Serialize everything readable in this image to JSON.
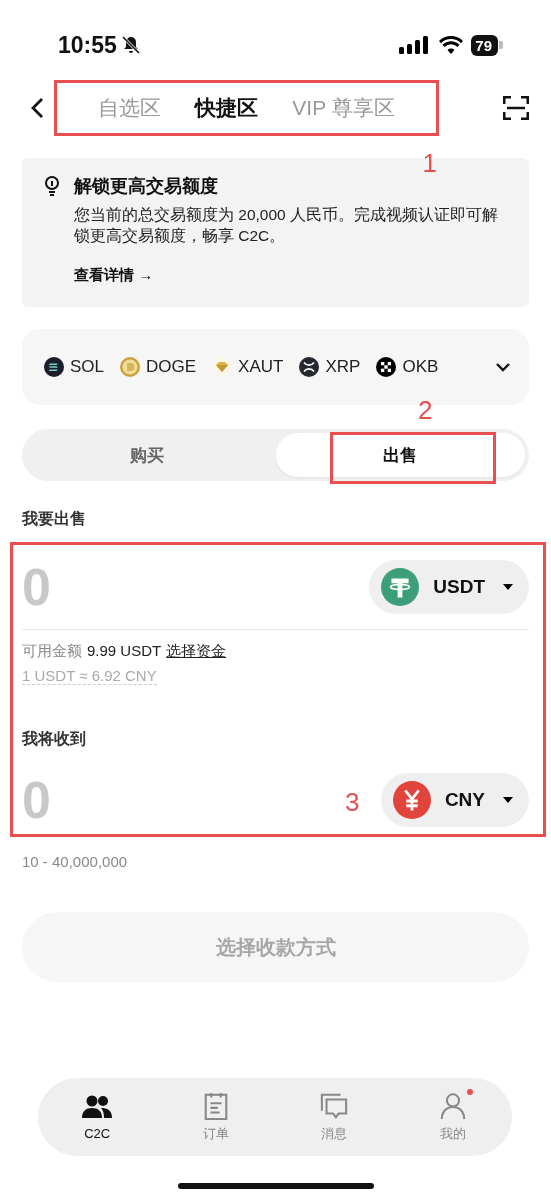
{
  "status_bar": {
    "time": "10:55",
    "battery": "79"
  },
  "nav": {
    "tabs": [
      {
        "label": "自选区",
        "selected": false
      },
      {
        "label": "快捷区",
        "selected": true
      },
      {
        "label": "VIP 尊享区",
        "selected": false
      }
    ]
  },
  "notice": {
    "title": "解锁更高交易额度",
    "body": "您当前的总交易额度为 20,000 人民币。完成视频认证即可解锁更高交易额度，畅享 C2C。",
    "link": "查看详情 →"
  },
  "coins": [
    {
      "symbol": "SOL",
      "kind": "sol"
    },
    {
      "symbol": "DOGE",
      "kind": "doge"
    },
    {
      "symbol": "XAUT",
      "kind": "xaut"
    },
    {
      "symbol": "XRP",
      "kind": "xrp"
    },
    {
      "symbol": "OKB",
      "kind": "okb"
    }
  ],
  "trade_toggle": [
    {
      "label": "购买",
      "selected": false
    },
    {
      "label": "出售",
      "selected": true
    }
  ],
  "sell": {
    "label": "我要出售",
    "placeholder": "0",
    "currency": "USDT",
    "kind": "usdt",
    "available_label": "可用金额",
    "available": "9.99 USDT",
    "select_funds": "选择资金",
    "rate": "1 USDT ≈ 6.92 CNY"
  },
  "receive": {
    "label": "我将收到",
    "placeholder": "0",
    "currency": "CNY",
    "kind": "cny",
    "range": "10 - 40,000,000"
  },
  "submit": {
    "label": "选择收款方式",
    "disabled": true
  },
  "bottom_nav": [
    {
      "label": "C2C",
      "kind": "c2c",
      "selected": true,
      "badge": false
    },
    {
      "label": "订单",
      "kind": "orders",
      "selected": false,
      "badge": false
    },
    {
      "label": "消息",
      "kind": "messages",
      "selected": false,
      "badge": false
    },
    {
      "label": "我的",
      "kind": "profile",
      "selected": false,
      "badge": true
    }
  ],
  "annotations": [
    {
      "label": "1"
    },
    {
      "label": "2"
    },
    {
      "label": "3"
    }
  ]
}
